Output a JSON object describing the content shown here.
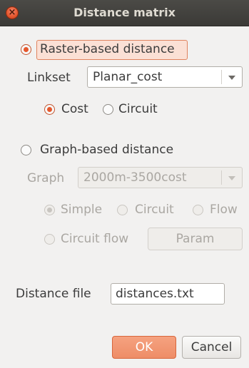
{
  "window": {
    "title": "Distance matrix"
  },
  "raster": {
    "label": "Raster-based distance",
    "checked": true,
    "linkset_label": "Linkset",
    "linkset_value": "Planar_cost",
    "cost_label": "Cost",
    "circuit_label": "Circuit"
  },
  "graph": {
    "label": "Graph-based distance",
    "checked": false,
    "graph_label": "Graph",
    "graph_value": "2000m-3500cost",
    "simple_label": "Simple",
    "circuit_label": "Circuit",
    "flow_label": "Flow",
    "circuit_flow_label": "Circuit flow",
    "param_label": "Param"
  },
  "output": {
    "distance_file_label": "Distance file",
    "distance_file_value": "distances.txt"
  },
  "buttons": {
    "ok": "OK",
    "cancel": "Cancel"
  },
  "colors": {
    "accent": "#e5572c",
    "titlebar": "#3c3b37"
  }
}
